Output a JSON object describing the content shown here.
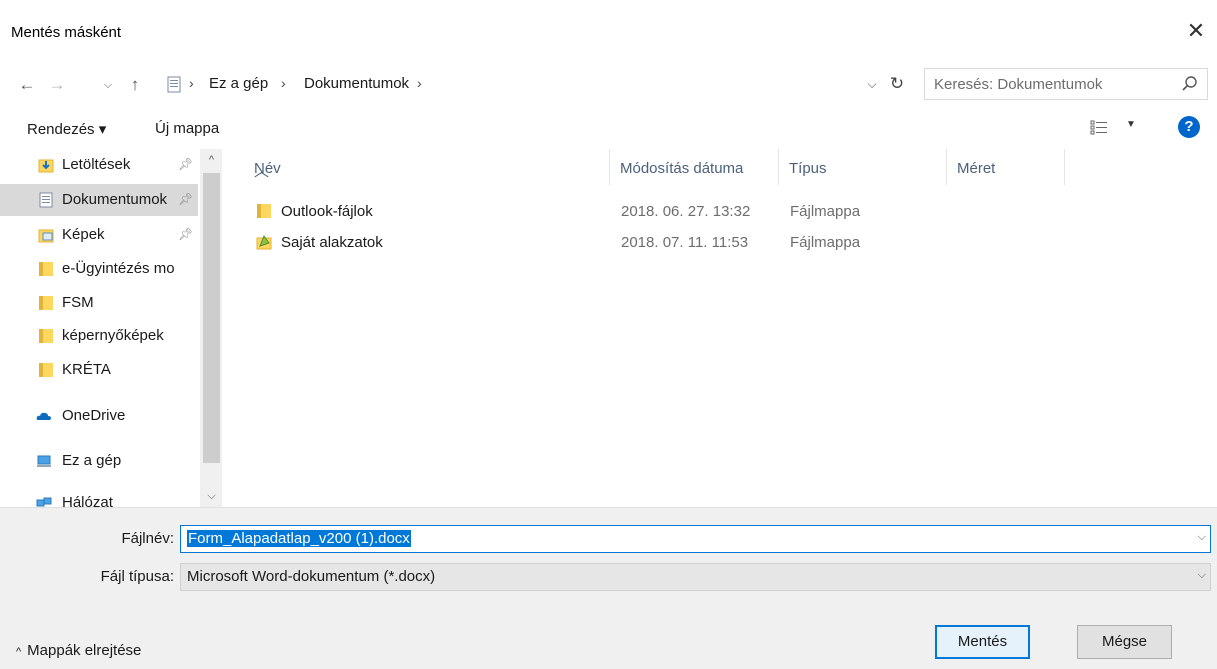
{
  "window": {
    "title": "Mentés másként"
  },
  "nav": {
    "breadcrumbs": [
      "Ez a gép",
      "Dokumentumok"
    ],
    "search_placeholder": "Keresés: Dokumentumok"
  },
  "toolbar": {
    "organize": "Rendezés ▾",
    "new_folder": "Új mappa"
  },
  "sidebar": {
    "items": [
      {
        "label": "Letöltések",
        "icon": "download-folder-icon",
        "pinned": true
      },
      {
        "label": "Dokumentumok",
        "icon": "documents-folder-icon",
        "pinned": true,
        "selected": true
      },
      {
        "label": "Képek",
        "icon": "pictures-folder-icon",
        "pinned": true
      },
      {
        "label": "e-Ügyintézés mo",
        "icon": "folder-icon"
      },
      {
        "label": "FSM",
        "icon": "folder-icon"
      },
      {
        "label": "képernyőképek",
        "icon": "folder-icon"
      },
      {
        "label": "KRÉTA",
        "icon": "folder-icon"
      },
      {
        "label": "OneDrive",
        "icon": "onedrive-icon"
      },
      {
        "label": "Ez a gép",
        "icon": "this-pc-icon"
      },
      {
        "label": "Hálózat",
        "icon": "network-icon"
      }
    ]
  },
  "files": {
    "columns": [
      "Név",
      "Módosítás dátuma",
      "Típus",
      "Méret"
    ],
    "rows": [
      {
        "name": "Outlook-fájlok",
        "date": "2018. 06. 27. 13:32",
        "type": "Fájlmappa",
        "icon": "folder-icon"
      },
      {
        "name": "Saját alakzatok",
        "date": "2018. 07. 11. 11:53",
        "type": "Fájlmappa",
        "icon": "shapes-folder-icon"
      }
    ]
  },
  "form": {
    "filename_label": "Fájlnév:",
    "filename_value": "Form_Alapadatlap_v200 (1).docx",
    "filetype_label": "Fájl típusa:",
    "filetype_value": "Microsoft Word-dokumentum (*.docx)",
    "hide_folders": "Mappák elrejtése",
    "save": "Mentés",
    "cancel": "Mégse"
  },
  "colors": {
    "accent": "#0078d7",
    "folder": "#ffd75e",
    "help": "#0066cc"
  }
}
